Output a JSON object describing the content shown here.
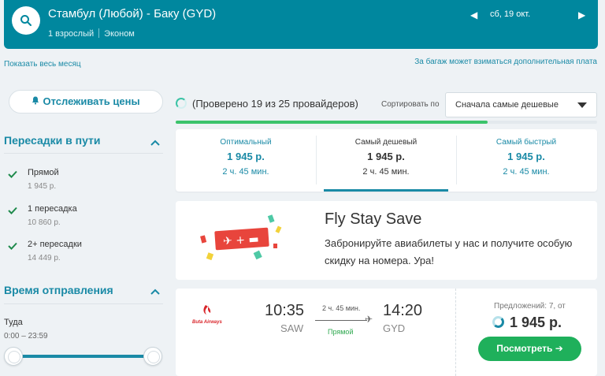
{
  "header": {
    "route": "Стамбул (Любой) - Баку (GYD)",
    "passengers": "1 взрослый",
    "cabin": "Эконом",
    "date": "сб, 19 окт."
  },
  "links": {
    "show_month": "Показать весь месяц",
    "baggage_note": "За багаж может взиматься дополнительная плата"
  },
  "sidebar": {
    "track_prices": "Отслеживать цены",
    "stops_title": "Пересадки в пути",
    "stops": [
      {
        "label": "Прямой",
        "price": "1 945 р.",
        "checked": true
      },
      {
        "label": "1 пересадка",
        "price": "10 860 р.",
        "checked": true
      },
      {
        "label": "2+ пересадки",
        "price": "14 449 р.",
        "checked": true
      }
    ],
    "departure_title": "Время отправления",
    "departure_city": "Туда",
    "departure_range": "0:00 – 23:59"
  },
  "status": {
    "checked_text": "(Проверено 19 из 25 провайдеров)",
    "progress": 0.74
  },
  "sort": {
    "label": "Сортировать по",
    "selected": "Сначала самые дешевые"
  },
  "tabs": [
    {
      "name": "Оптимальный",
      "price": "1 945 р.",
      "duration": "2 ч. 45 мин."
    },
    {
      "name": "Самый дешевый",
      "price": "1 945 р.",
      "duration": "2 ч. 45 мин."
    },
    {
      "name": "Самый быстрый",
      "price": "1 945 р.",
      "duration": "2 ч. 45 мин."
    }
  ],
  "ad": {
    "title": "Fly Stay Save",
    "text": "Забронируйте авиабилеты у нас и получите особую скидку на номера. Ура!"
  },
  "flight": {
    "airline": "Buta Airways",
    "dep_time": "10:35",
    "dep_code": "SAW",
    "arr_time": "14:20",
    "arr_code": "GYD",
    "duration": "2 ч. 45 мин.",
    "stops": "Прямой",
    "offers": "Предложений: 7, от",
    "price": "1 945 р.",
    "view_button": "Посмотреть"
  },
  "colors": {
    "header_bg": "#00879e",
    "accent": "#1a8aa6",
    "green": "#1fb05b"
  }
}
